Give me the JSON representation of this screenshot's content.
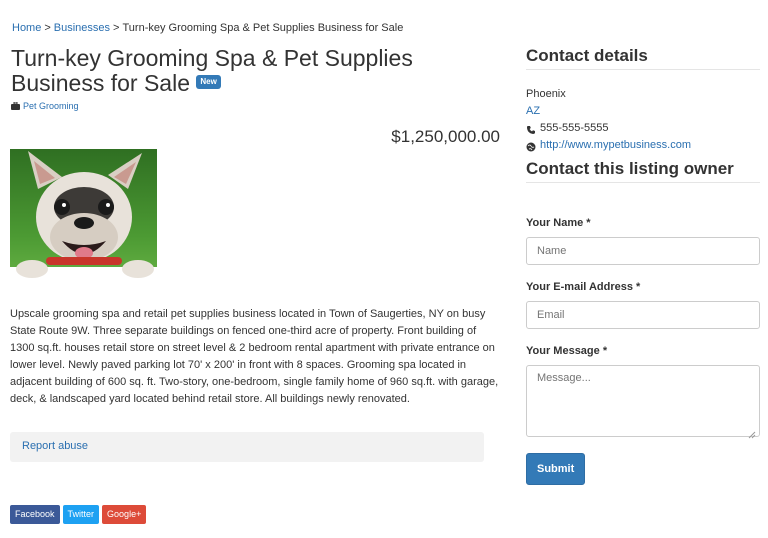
{
  "breadcrumb": {
    "home": "Home",
    "sep1": ">",
    "businesses": "Businesses",
    "sep2": ">",
    "current": "Turn-key Grooming Spa & Pet Supplies Business for Sale"
  },
  "listing": {
    "title": "Turn-key Grooming Spa & Pet Supplies Business for Sale",
    "badge": "New",
    "category": "Pet Grooming",
    "price": "$1,250,000.00",
    "description": "Upscale grooming spa and retail pet supplies business located in Town of Saugerties, NY on busy State Route 9W. Three separate buildings on fenced one-third acre of property. Front building of 1300 sq.ft. houses retail store on street level & 2 bedroom rental apartment with private entrance on lower level. Newly paved parking lot 70' x 200' in front with 8 spaces. Grooming spa located in adjacent building of 600 sq. ft. Two-story, one-bedroom, single family home of 960 sq.ft. with garage, deck, & landscaped yard located behind retail store. All buildings newly renovated.",
    "report": "Report abuse"
  },
  "social": {
    "facebook": "Facebook",
    "twitter": "Twitter",
    "googleplus": "Google+"
  },
  "sidebar": {
    "contact_heading": "Contact details",
    "city": "Phoenix",
    "state": "AZ",
    "phone": "555-555-5555",
    "website": "http://www.mypetbusiness.com",
    "form_heading": "Contact this listing owner",
    "name_label": "Your Name *",
    "name_placeholder": "Name",
    "email_label": "Your E-mail Address *",
    "email_placeholder": "Email",
    "message_label": "Your Message *",
    "message_placeholder": "Message...",
    "submit": "Submit"
  },
  "colors": {
    "link": "#2a6fb0",
    "primary": "#337ab7",
    "facebook": "#3b5998",
    "twitter": "#1da1f2",
    "googleplus": "#dd4b39"
  },
  "icons": [
    "briefcase-icon",
    "phone-icon",
    "globe-icon"
  ]
}
